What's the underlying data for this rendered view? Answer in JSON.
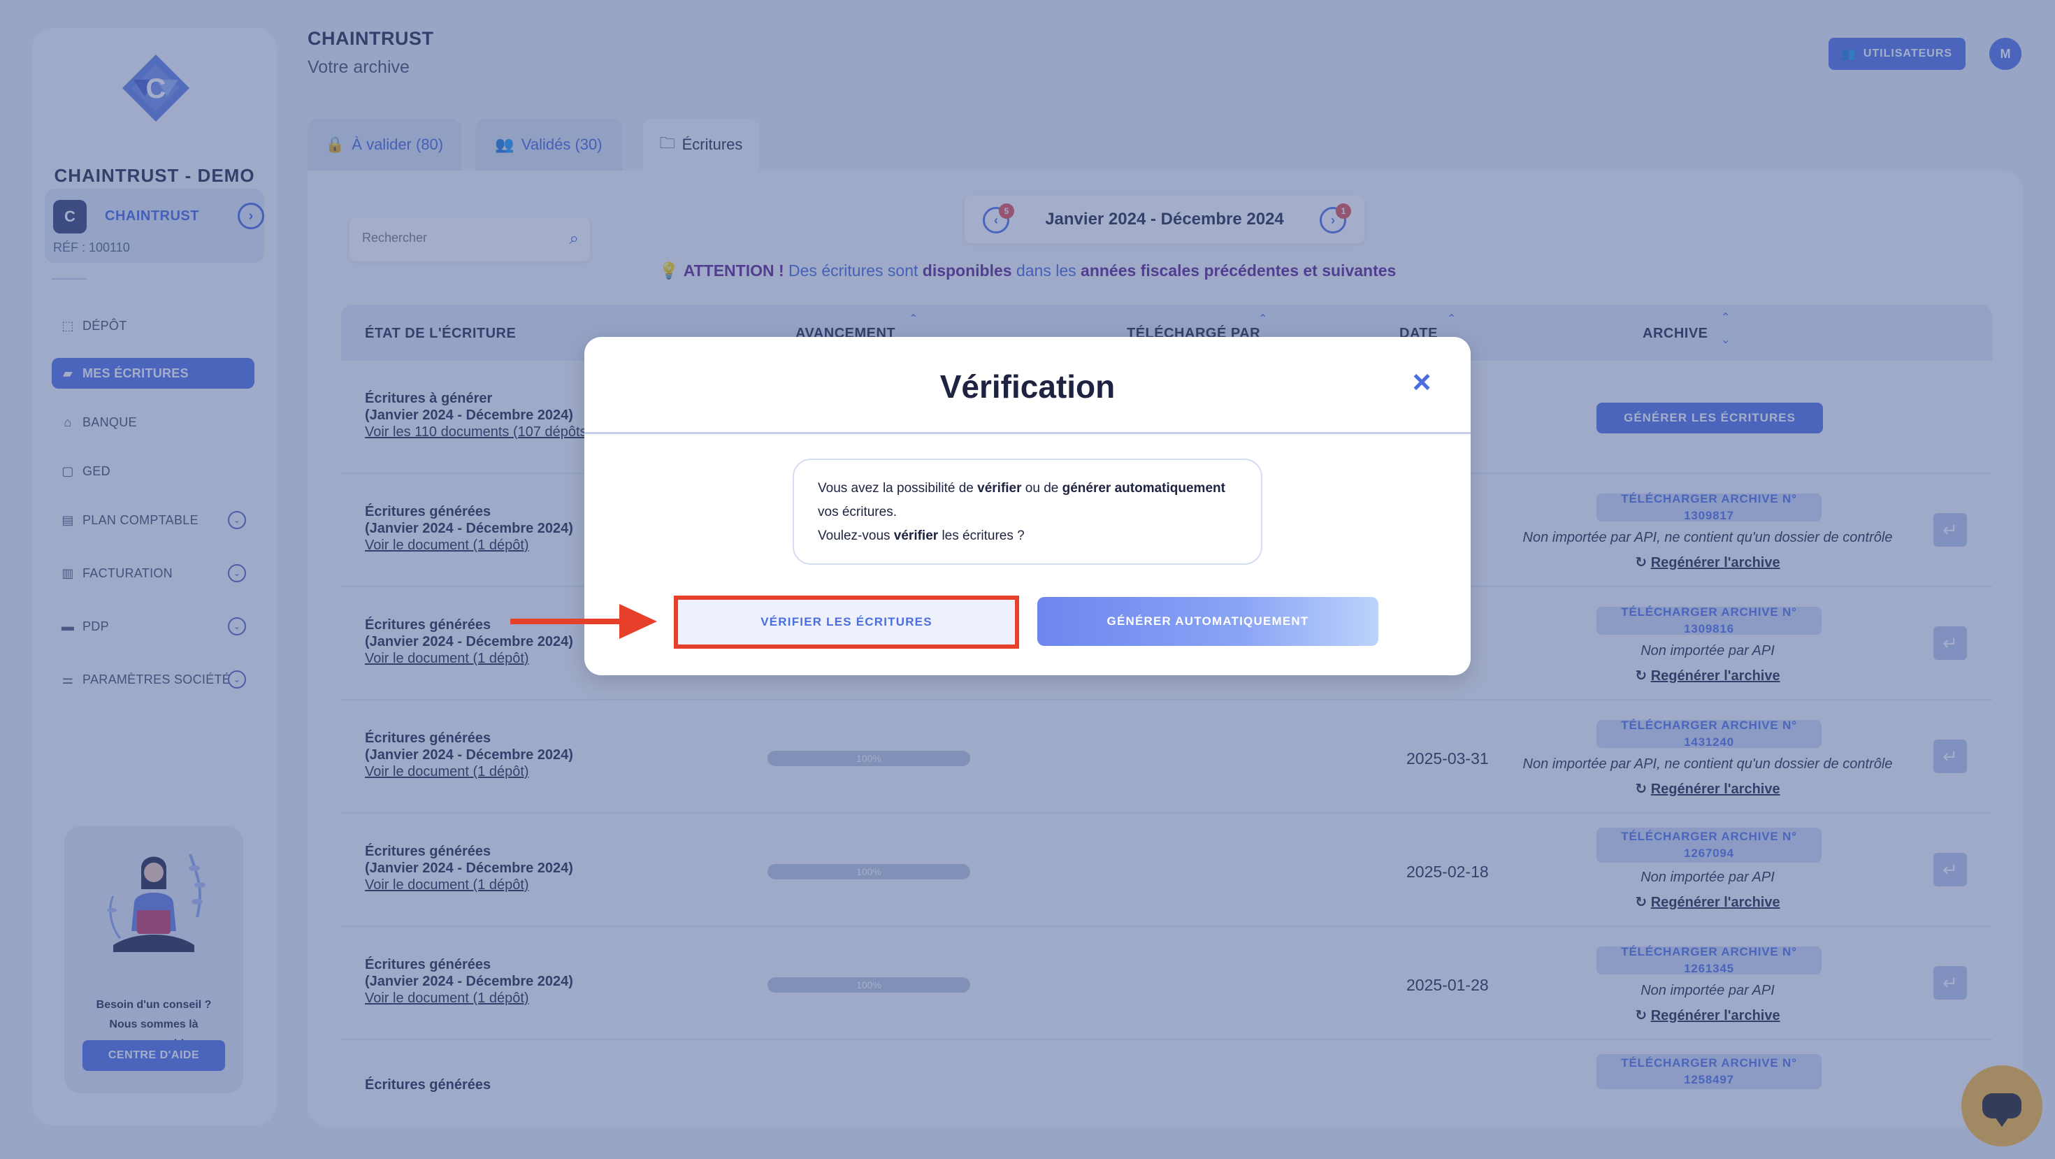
{
  "sidebar": {
    "org_name": "CHAINTRUST - DEMO",
    "org_card": {
      "logo_letter": "C",
      "link": "CHAINTRUST",
      "ref": "RÉF : 100110"
    },
    "nav": [
      {
        "label": "DÉPÔT",
        "icon": "upload-icon"
      },
      {
        "label": "MES ÉCRITURES",
        "icon": "entries-icon",
        "active": true
      },
      {
        "label": "BANQUE",
        "icon": "bank-icon"
      },
      {
        "label": "GED",
        "icon": "document-icon"
      },
      {
        "label": "PLAN COMPTABLE",
        "icon": "ledger-icon",
        "expandable": true
      },
      {
        "label": "FACTURATION",
        "icon": "invoice-icon",
        "expandable": true
      },
      {
        "label": "PDP",
        "icon": "card-icon",
        "expandable": true
      },
      {
        "label": "PARAMÈTRES SOCIÉTÉ",
        "icon": "sliders-icon",
        "expandable": true
      }
    ],
    "help": {
      "line1": "Besoin d'un conseil ?",
      "line2": "Nous sommes là",
      "line3": "pour vous aider.",
      "button": "CENTRE D'AIDE"
    }
  },
  "header": {
    "title": "CHAINTRUST",
    "subtitle": "Votre archive",
    "users_button": "UTILISATEURS",
    "avatar_initial": "M"
  },
  "tabs": [
    {
      "label": "À valider (80)"
    },
    {
      "label": "Validés (30)"
    },
    {
      "label": "Écritures",
      "active": true
    }
  ],
  "search": {
    "placeholder": "Rechercher"
  },
  "period": {
    "label": "Janvier 2024 - Décembre 2024",
    "prev_badge": "5",
    "next_badge": "1"
  },
  "attention": {
    "prefix": "ATTENTION !",
    "part1": " Des écritures sont ",
    "bold1": "disponibles",
    "part2": " dans les ",
    "bold2": "années fiscales précédentes et suivantes"
  },
  "table": {
    "headers": {
      "state": "ÉTAT DE L'ÉCRITURE",
      "progress": "AVANCEMENT",
      "uploaded_by": "TÉLÉCHARGÉ PAR",
      "date": "DATE",
      "archive": "ARCHIVE"
    },
    "rows": [
      {
        "t1": "Écritures à générer",
        "t2": "(Janvier 2024 - Décembre 2024)",
        "t3": "Voir les 110 documents (107 dépôts)",
        "generate_button": "GÉNÉRER LES ÉCRITURES"
      },
      {
        "t1": "Écritures générées",
        "t2": "(Janvier 2024 - Décembre 2024)",
        "t3": "Voir le document (1 dépôt)",
        "archive_button": "TÉLÉCHARGER ARCHIVE N° 1309817",
        "note": "Non importée par API, ne contient qu'un dossier de contrôle",
        "regen": "Regénérer l'archive"
      },
      {
        "t1": "Écritures générées",
        "t2": "(Janvier 2024 - Décembre 2024)",
        "t3": "Voir le document (1 dépôt)",
        "archive_button": "TÉLÉCHARGER ARCHIVE N° 1309816",
        "note": "Non importée par API",
        "regen": "Regénérer l'archive"
      },
      {
        "t1": "Écritures générées",
        "t2": "(Janvier 2024 - Décembre 2024)",
        "t3": "Voir le document (1 dépôt)",
        "progress": "100%",
        "date": "2025-03-31",
        "archive_button": "TÉLÉCHARGER ARCHIVE N° 1431240",
        "note": "Non importée par API, ne contient qu'un dossier de contrôle",
        "regen": "Regénérer l'archive"
      },
      {
        "t1": "Écritures générées",
        "t2": "(Janvier 2024 - Décembre 2024)",
        "t3": "Voir le document (1 dépôt)",
        "progress": "100%",
        "date": "2025-02-18",
        "archive_button": "TÉLÉCHARGER ARCHIVE N° 1267094",
        "note": "Non importée par API",
        "regen": "Regénérer l'archive"
      },
      {
        "t1": "Écritures générées",
        "t2": "(Janvier 2024 - Décembre 2024)",
        "t3": "Voir le document (1 dépôt)",
        "progress": "100%",
        "date": "2025-01-28",
        "archive_button": "TÉLÉCHARGER ARCHIVE N° 1261345",
        "note": "Non importée par API",
        "regen": "Regénérer l'archive"
      },
      {
        "t1": "Écritures générées",
        "archive_button": "TÉLÉCHARGER ARCHIVE N° 1258497"
      }
    ]
  },
  "modal": {
    "title": "Vérification",
    "msg_part1": "Vous avez la possibilité de ",
    "msg_bold1": "vérifier",
    "msg_part2": " ou de ",
    "msg_bold2": "générer automatiquement",
    "msg_part3": "vos écritures.",
    "msg_part4": "Voulez-vous ",
    "msg_bold3": "vérifier",
    "msg_part5": " les écritures ?",
    "verify_button": "VÉRIFIER LES ÉCRITURES",
    "auto_button": "GÉNÉRER AUTOMATIQUEMENT"
  },
  "colors": {
    "accent": "#4a6de0",
    "highlight": "#e6402a",
    "overlay": "#4a5e96",
    "chat": "#f6b531"
  }
}
